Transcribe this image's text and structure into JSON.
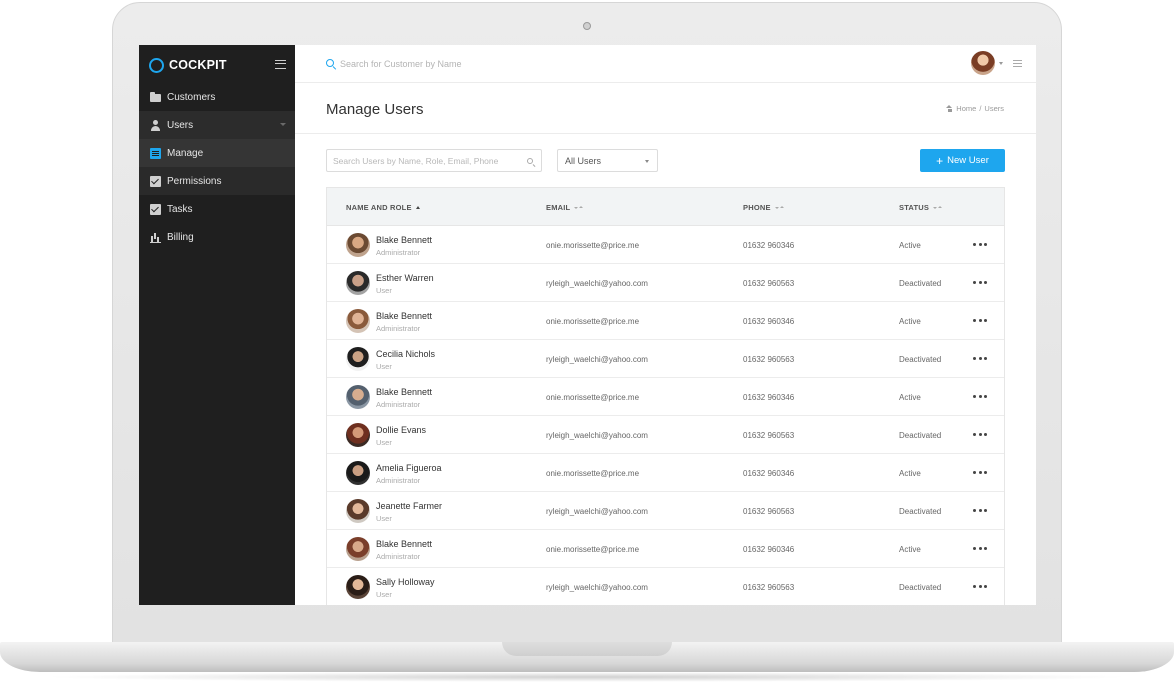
{
  "sidebar": {
    "brand": "COCKPIT",
    "items": [
      {
        "label": "Customers",
        "icon": "folder-icon"
      },
      {
        "label": "Users",
        "icon": "user-icon"
      },
      {
        "label": "Manage",
        "icon": "document-icon"
      },
      {
        "label": "Permissions",
        "icon": "checkbox-icon"
      },
      {
        "label": "Tasks",
        "icon": "checkbox-icon"
      },
      {
        "label": "Billing",
        "icon": "bar-chart-icon"
      }
    ]
  },
  "topbar": {
    "search_placeholder": "Search for Customer by Name"
  },
  "page": {
    "title": "Manage Users",
    "breadcrumb": [
      "Home",
      "Users"
    ]
  },
  "filters": {
    "search_placeholder": "Search Users by Name, Role, Email, Phone",
    "select_value": "All Users",
    "new_user_label": "New User"
  },
  "table": {
    "headers": [
      "NAME AND ROLE",
      "EMAIL",
      "PHONE",
      "STATUS"
    ],
    "rows": [
      {
        "name": "Blake Bennett",
        "role": "Administrator",
        "email": "onie.morissette@price.me",
        "phone": "01632 960346",
        "status": "Active"
      },
      {
        "name": "Esther Warren",
        "role": "User",
        "email": "ryleigh_waelchi@yahoo.com",
        "phone": "01632 960563",
        "status": "Deactivated"
      },
      {
        "name": "Blake Bennett",
        "role": "Administrator",
        "email": "onie.morissette@price.me",
        "phone": "01632 960346",
        "status": "Active"
      },
      {
        "name": "Cecilia Nichols",
        "role": "User",
        "email": "ryleigh_waelchi@yahoo.com",
        "phone": "01632 960563",
        "status": "Deactivated"
      },
      {
        "name": "Blake Bennett",
        "role": "Administrator",
        "email": "onie.morissette@price.me",
        "phone": "01632 960346",
        "status": "Active"
      },
      {
        "name": "Dollie Evans",
        "role": "User",
        "email": "ryleigh_waelchi@yahoo.com",
        "phone": "01632 960563",
        "status": "Deactivated"
      },
      {
        "name": "Amelia Figueroa",
        "role": "Administrator",
        "email": "onie.morissette@price.me",
        "phone": "01632 960346",
        "status": "Active"
      },
      {
        "name": "Jeanette Farmer",
        "role": "User",
        "email": "ryleigh_waelchi@yahoo.com",
        "phone": "01632 960563",
        "status": "Deactivated"
      },
      {
        "name": "Blake Bennett",
        "role": "Administrator",
        "email": "onie.morissette@price.me",
        "phone": "01632 960346",
        "status": "Active"
      },
      {
        "name": "Sally Holloway",
        "role": "User",
        "email": "ryleigh_waelchi@yahoo.com",
        "phone": "01632 960563",
        "status": "Deactivated"
      }
    ]
  },
  "colors": {
    "accent": "#1ea6ee",
    "sidebar_bg": "#1f1f1f"
  }
}
